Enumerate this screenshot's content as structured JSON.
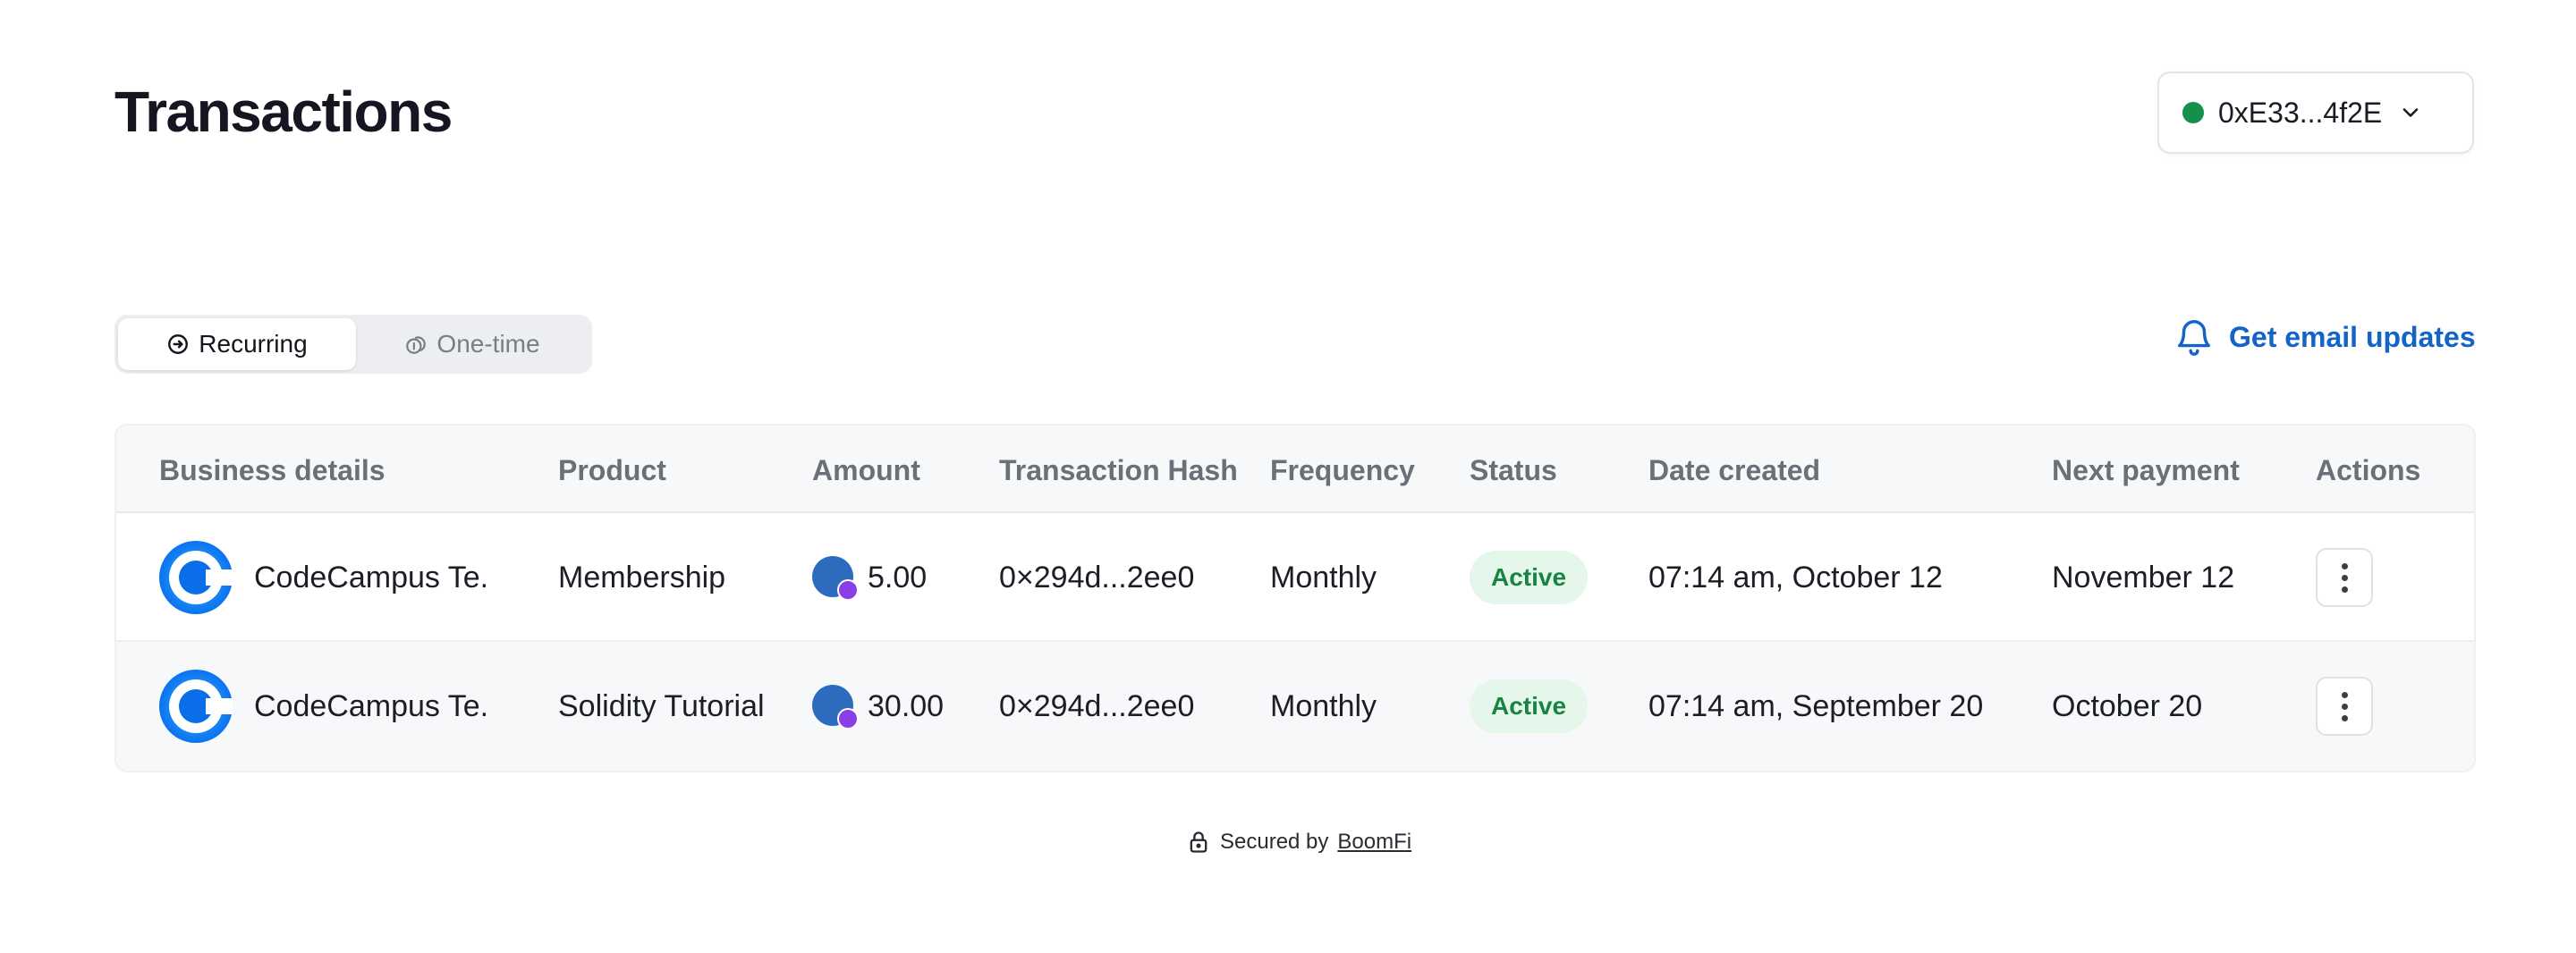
{
  "header": {
    "title": "Transactions",
    "wallet": {
      "address": "0xE33...4f2E",
      "status_color": "#14904a"
    }
  },
  "tabs": [
    {
      "label": "Recurring",
      "icon": "recurring-icon",
      "active": true
    },
    {
      "label": "One-time",
      "icon": "coins-icon",
      "active": false
    }
  ],
  "email_updates": {
    "label": "Get email updates",
    "icon": "bell-icon"
  },
  "table": {
    "columns": [
      "Business details",
      "Product",
      "Amount",
      "Transaction Hash",
      "Frequency",
      "Status",
      "Date created",
      "Next payment",
      "Actions"
    ],
    "rows": [
      {
        "business": "CodeCampus Te.",
        "product": "Membership",
        "amount": "5.00",
        "hash": "0×294d...2ee0",
        "frequency": "Monthly",
        "status": "Active",
        "date_created": "07:14 am, October 12",
        "next_payment": "November 12"
      },
      {
        "business": "CodeCampus Te.",
        "product": "Solidity Tutorial",
        "amount": "30.00",
        "hash": "0×294d...2ee0",
        "frequency": "Monthly",
        "status": "Active",
        "date_created": "07:14 am, September 20",
        "next_payment": "October 20"
      }
    ]
  },
  "footer": {
    "prefix": "Secured by",
    "brand": "BoomFi",
    "icon": "lock-icon"
  },
  "colors": {
    "accent": "#1463c9",
    "active_badge_bg": "#e5f6ea",
    "active_badge_text": "#17853f"
  }
}
